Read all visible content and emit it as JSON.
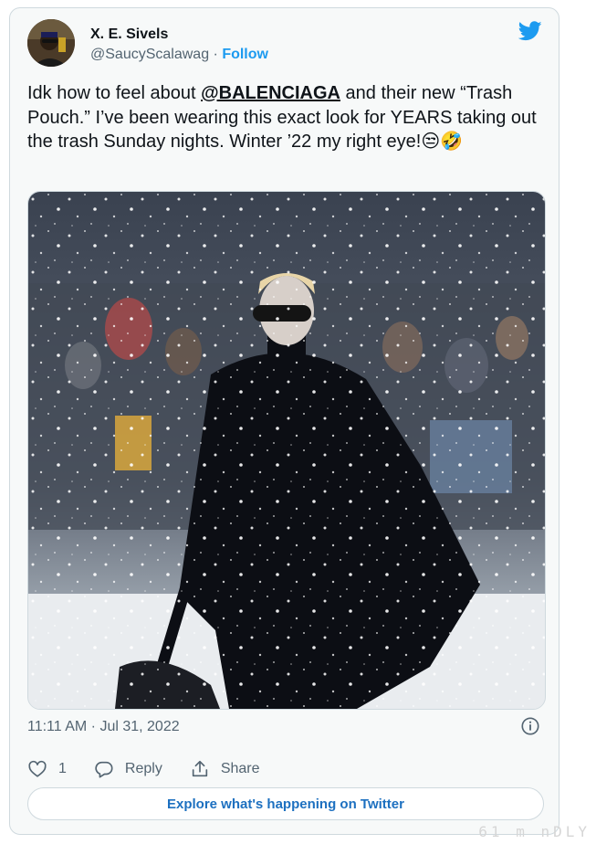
{
  "user": {
    "display_name": "X. E. Sivels",
    "handle": "@SaucyScalawag",
    "separator": " · ",
    "follow_label": "Follow"
  },
  "tweet": {
    "text_before": "Idk how to feel about ",
    "mention": "@BALENCIAGA",
    "text_after": " and their new “Trash Pouch.” I’ve been wearing this exact look for YEARS taking out the trash Sunday nights. Winter ’22 my right eye!",
    "emojis": "😒🤣",
    "timestamp": "11:11 AM · Jul 31, 2022",
    "like_count": "1",
    "reply_label": "Reply",
    "share_label": "Share"
  },
  "explore_label": "Explore what's happening on Twitter",
  "watermark": "61 m  nDLY",
  "icons": {
    "brand": "twitter-bird-icon",
    "like": "heart-icon",
    "reply": "reply-bubble-icon",
    "share": "share-icon",
    "info": "info-icon"
  },
  "colors": {
    "accent": "#1d9bf0",
    "text": "#0f1419",
    "secondary": "#536471",
    "border": "#cfd9de",
    "card_bg": "#f7f9f9"
  }
}
